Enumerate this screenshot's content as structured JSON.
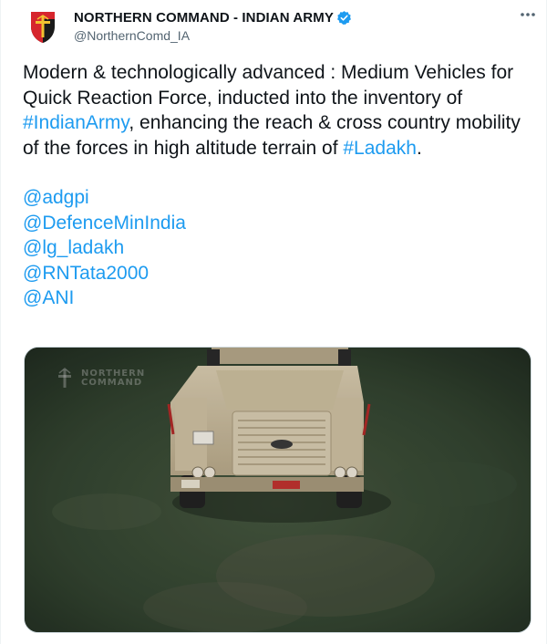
{
  "account": {
    "display_name": "NORTHERN COMMAND - INDIAN ARMY",
    "handle": "@NorthernComd_IA",
    "verified_icon": "verified-badge-icon",
    "avatar_colors": [
      "#d6262d",
      "#1a1a1a",
      "#f2c230"
    ]
  },
  "more_icon": "more-options-icon",
  "tweet": {
    "intro": "Modern & technologically advanced : Medium Vehicles for Quick Reaction Force,  inducted into the inventory of ",
    "hashtag1": "#IndianArmy",
    "middle": ", enhancing the reach & cross country mobility of the forces in high altitude terrain of ",
    "hashtag2": "#Ladakh",
    "end": ".",
    "mentions": [
      "@adgpi",
      "@DefenceMinIndia",
      "@lg_ladakh",
      "@RNTata2000",
      "@ANI"
    ]
  },
  "media": {
    "watermark_line1": "NORTHERN",
    "watermark_line2": "COMMAND"
  },
  "colors": {
    "link": "#1d9bf0",
    "text": "#0f1419",
    "secondary": "#536471",
    "border": "#cfd9de"
  }
}
